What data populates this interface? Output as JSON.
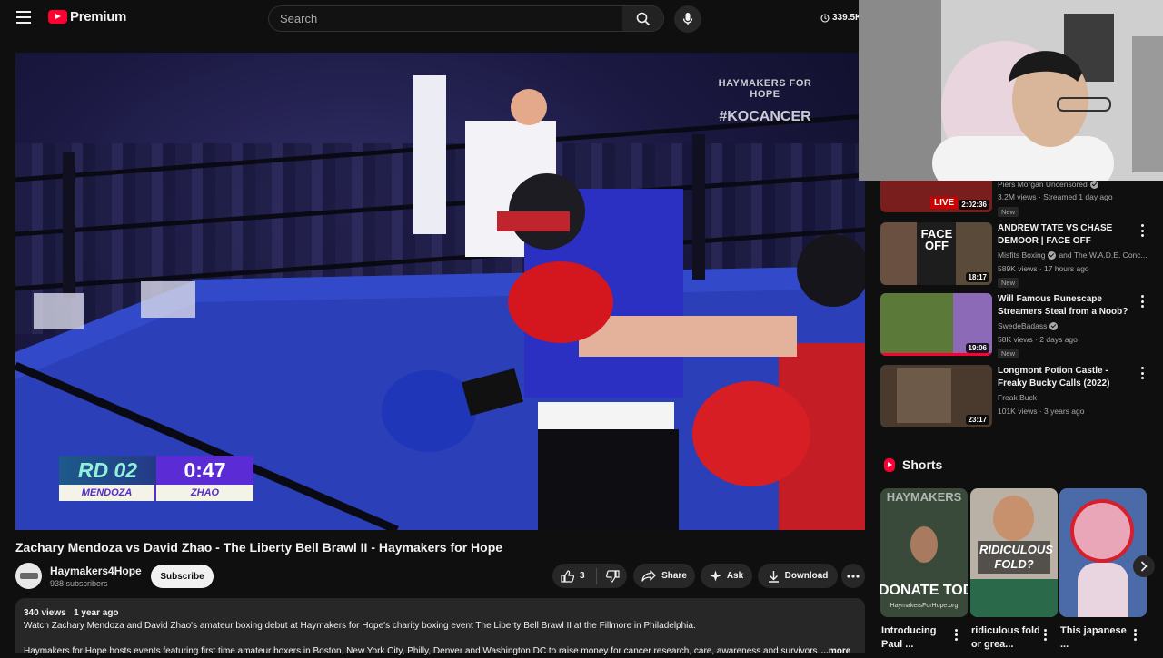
{
  "header": {
    "brand": "Premium",
    "search_placeholder": "Search",
    "timer": "339.5K"
  },
  "player": {
    "watermark_line1": "HAYMAKERS FOR HOPE",
    "watermark_line2": "#KOCANCER",
    "round": "RD 02",
    "clock": "0:47",
    "fighter1": "MENDOZA",
    "fighter2": "ZHAO"
  },
  "video": {
    "title": "Zachary Mendoza vs David Zhao - The Liberty Bell Brawl II - Haymakers for Hope",
    "channel": "Haymakers4Hope",
    "subscribers": "938 subscribers",
    "subscribe_label": "Subscribe",
    "likes": "3",
    "share_label": "Share",
    "ask_label": "Ask",
    "download_label": "Download"
  },
  "description": {
    "views": "340 views",
    "age": "1 year ago",
    "line1": "Watch Zachary Mendoza and David Zhao's amateur boxing debut at Haymakers for Hope's charity boxing event The Liberty Bell Brawl II at the Fillmore in Philadelphia.",
    "line2": "Haymakers for Hope hosts events featuring first time amateur boxers in Boston, New York City, Philly, Denver and Washington DC to raise money for cancer research, care, awareness and survivors",
    "more_label": "...more"
  },
  "recommendations": [
    {
      "title": "",
      "channel": "Piers Morgan Uncensored",
      "meta": "3.2M views · Streamed 1 day ago",
      "badge": "New",
      "duration": "2:02:36",
      "live": "LIVE",
      "thumb_color": "#7a1d1d"
    },
    {
      "title": "ANDREW TATE VS CHASE DEMOOR | FACE OFF",
      "channel": "Misfits Boxing",
      "channel_extra": "and The W.A.D.E. Conc...",
      "meta": "589K views · 17 hours ago",
      "badge": "New",
      "duration": "18:17",
      "thumb_text": "FACE OFF",
      "thumb_color": "#1d1d1d"
    },
    {
      "title": "Will Famous Runescape Streamers Steal from a Noob?",
      "channel": "SwedeBadass",
      "meta": "58K views · 2 days ago",
      "badge": "New",
      "duration": "19:06",
      "thumb_color": "#6b6a3a"
    },
    {
      "title": "Longmont Potion Castle - Freaky Bucky Calls (2022)",
      "channel": "Freak Buck",
      "meta": "101K views · 3 years ago",
      "duration": "23:17",
      "thumb_color": "#4a3a2e"
    }
  ],
  "shorts": {
    "heading": "Shorts",
    "items": [
      {
        "title": "Introducing Paul ...",
        "overlay": "DONATE TODAY",
        "overlay_small": "HaymakersForHope.org",
        "top_text": "HAYMAKERS",
        "color": "#3a4a3a"
      },
      {
        "title": "ridiculous fold or grea...",
        "overlay": "RIDICULOUS FOLD?",
        "color": "#b9b1a6"
      },
      {
        "title": "This japanese ...",
        "color": "#4a6aa8"
      }
    ]
  }
}
